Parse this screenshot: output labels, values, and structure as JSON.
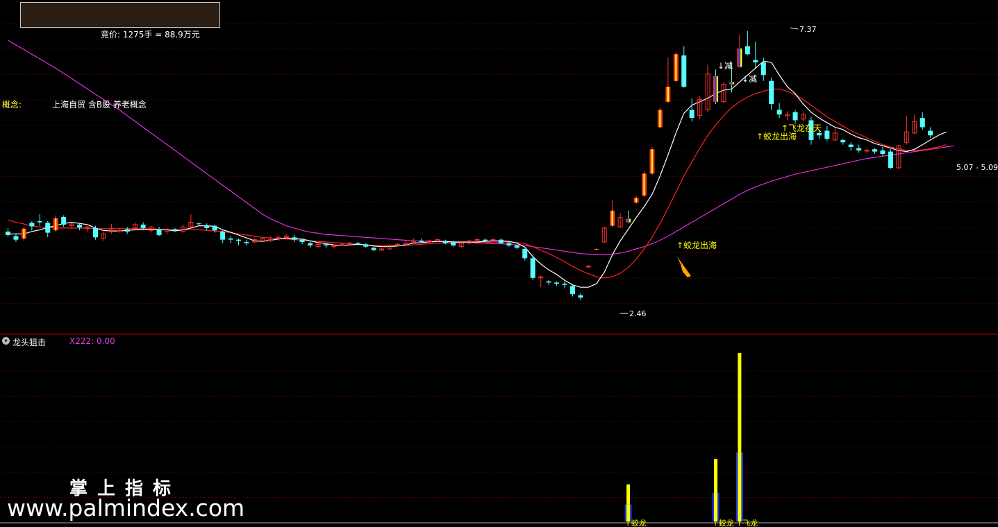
{
  "header": {
    "auction_text": "竞价: 1275手 = 88.9万元",
    "concept_label": "概念:",
    "concept_value": "上海自贸 含B股 养老概念"
  },
  "indicator": {
    "name": "龙头狙击",
    "value_text": "X222: 0.00"
  },
  "watermark": {
    "cn": "掌上指标",
    "url": "www.palmindex.com"
  },
  "colors": {
    "background": "#000000",
    "up_candle": "#ff3232",
    "down_candle": "#54ffff",
    "ma5": "#ffffff",
    "ma10": "#ff2020",
    "ma60": "#e030e0",
    "signal_yellow": "#ffff00",
    "signal_blue": "#2040ff",
    "grid": "#8b0000",
    "pane_border": "#c00000",
    "arrow": "#ffa500"
  },
  "chart_data": {
    "type": "candlestick",
    "price_range": [
      2.2,
      7.8
    ],
    "annotations": {
      "high_label": "7.37",
      "low_label": "2.46",
      "range_label": "5.07 - 5.09",
      "signal_labels": [
        "↓减",
        "↓减",
        "↑蛟龙出海",
        "↑蛟龙出海",
        "↑飞龙在天"
      ],
      "bottom_labels": [
        "↑蛟龙",
        "↑蛟龙",
        "↑飞龙"
      ]
    },
    "candles": [
      [
        3.9,
        3.84,
        3.96,
        3.8
      ],
      [
        3.82,
        3.76,
        3.86,
        3.72
      ],
      [
        3.78,
        3.95,
        3.98,
        3.74
      ],
      [
        4.05,
        3.99,
        4.08,
        3.92
      ],
      [
        4.08,
        4.06,
        4.2,
        4.0
      ],
      [
        4.05,
        3.88,
        4.08,
        3.8
      ],
      [
        3.92,
        4.13,
        4.18,
        3.9
      ],
      [
        4.15,
        4.02,
        4.18,
        3.98
      ],
      [
        4.0,
        4.03,
        4.06,
        3.96
      ],
      [
        4.02,
        3.97,
        4.05,
        3.92
      ],
      [
        3.95,
        3.98,
        4.0,
        3.9
      ],
      [
        3.96,
        3.8,
        4.0,
        3.76
      ],
      [
        3.78,
        3.86,
        3.9,
        3.74
      ],
      [
        3.9,
        3.95,
        4.03,
        3.86
      ],
      [
        3.92,
        3.92,
        3.96,
        3.88
      ],
      [
        3.94,
        3.9,
        3.98,
        3.86
      ],
      [
        3.96,
        4.02,
        4.06,
        3.94
      ],
      [
        4.02,
        3.96,
        4.06,
        3.92
      ],
      [
        3.92,
        3.98,
        4.0,
        3.88
      ],
      [
        3.94,
        3.84,
        3.98,
        3.82
      ],
      [
        3.9,
        3.94,
        3.96,
        3.86
      ],
      [
        3.94,
        3.92,
        3.96,
        3.9
      ],
      [
        3.9,
        3.98,
        4.02,
        3.88
      ],
      [
        3.98,
        4.06,
        4.2,
        3.96
      ],
      [
        4.04,
        4.03,
        4.06,
        4.0
      ],
      [
        4.0,
        3.96,
        4.04,
        3.92
      ],
      [
        4.0,
        3.92,
        4.02,
        3.88
      ],
      [
        3.9,
        3.76,
        3.92,
        3.7
      ],
      [
        3.78,
        3.76,
        3.82,
        3.7
      ],
      [
        3.76,
        3.74,
        3.78,
        3.66
      ],
      [
        3.72,
        3.7,
        3.76,
        3.66
      ],
      [
        3.72,
        3.76,
        3.78,
        3.7
      ],
      [
        3.74,
        3.78,
        3.8,
        3.72
      ],
      [
        3.76,
        3.76,
        3.82,
        3.72
      ],
      [
        3.78,
        3.8,
        3.84,
        3.74
      ],
      [
        3.8,
        3.82,
        3.86,
        3.78
      ],
      [
        3.8,
        3.76,
        3.84,
        3.72
      ],
      [
        3.76,
        3.72,
        3.78,
        3.68
      ],
      [
        3.7,
        3.66,
        3.74,
        3.62
      ],
      [
        3.64,
        3.68,
        3.72,
        3.62
      ],
      [
        3.68,
        3.66,
        3.7,
        3.62
      ],
      [
        3.64,
        3.66,
        3.68,
        3.62
      ],
      [
        3.66,
        3.68,
        3.72,
        3.64
      ],
      [
        3.68,
        3.7,
        3.72,
        3.66
      ],
      [
        3.7,
        3.68,
        3.72,
        3.66
      ],
      [
        3.68,
        3.64,
        3.7,
        3.62
      ],
      [
        3.62,
        3.58,
        3.64,
        3.56
      ],
      [
        3.58,
        3.6,
        3.62,
        3.56
      ],
      [
        3.6,
        3.66,
        3.68,
        3.58
      ],
      [
        3.66,
        3.68,
        3.7,
        3.64
      ],
      [
        3.68,
        3.7,
        3.74,
        3.66
      ],
      [
        3.72,
        3.74,
        3.78,
        3.7
      ],
      [
        3.74,
        3.72,
        3.78,
        3.7
      ],
      [
        3.72,
        3.74,
        3.76,
        3.7
      ],
      [
        3.74,
        3.76,
        3.78,
        3.72
      ],
      [
        3.74,
        3.7,
        3.76,
        3.68
      ],
      [
        3.72,
        3.66,
        3.74,
        3.64
      ],
      [
        3.64,
        3.7,
        3.72,
        3.62
      ],
      [
        3.7,
        3.74,
        3.76,
        3.68
      ],
      [
        3.74,
        3.76,
        3.78,
        3.72
      ],
      [
        3.76,
        3.74,
        3.78,
        3.72
      ],
      [
        3.76,
        3.76,
        3.78,
        3.74
      ],
      [
        3.76,
        3.7,
        3.78,
        3.68
      ],
      [
        3.7,
        3.66,
        3.72,
        3.64
      ],
      [
        3.66,
        3.62,
        3.68,
        3.6
      ],
      [
        3.6,
        3.44,
        3.62,
        3.4
      ],
      [
        3.44,
        3.1,
        3.46,
        3.06
      ],
      [
        3.1,
        3.12,
        3.14,
        2.94
      ],
      [
        3.04,
        3.02,
        3.06,
        2.98
      ],
      [
        3.02,
        3.0,
        3.04,
        2.96
      ],
      [
        3.0,
        2.98,
        3.04,
        2.92
      ],
      [
        2.96,
        2.82,
        2.98,
        2.78
      ],
      [
        2.8,
        2.76,
        2.84,
        2.72
      ],
      [
        3.3,
        3.3,
        3.32,
        3.28
      ],
      [
        3.6,
        3.6,
        3.62,
        3.58
      ],
      [
        3.72,
        3.96,
        3.98,
        3.7
      ],
      [
        4.0,
        4.26,
        4.44,
        3.98
      ],
      [
        3.98,
        4.14,
        4.22,
        3.96
      ],
      [
        4.12,
        4.06,
        4.26,
        4.04
      ],
      [
        4.4,
        4.48,
        4.52,
        4.38
      ],
      [
        4.52,
        4.9,
        4.94,
        4.5
      ],
      [
        4.9,
        5.32,
        5.36,
        4.88
      ],
      [
        5.7,
        6.0,
        6.04,
        5.68
      ],
      [
        6.14,
        6.4,
        6.9,
        6.12
      ],
      [
        6.5,
        6.96,
        7.0,
        6.48
      ],
      [
        6.94,
        6.4,
        7.1,
        6.38
      ],
      [
        6.0,
        5.86,
        6.2,
        5.8
      ],
      [
        5.9,
        6.18,
        6.24,
        5.84
      ],
      [
        6.0,
        6.62,
        6.78,
        5.96
      ],
      [
        6.58,
        6.14,
        6.7,
        6.1
      ],
      [
        6.14,
        6.44,
        6.48,
        6.12
      ],
      [
        6.48,
        6.44,
        6.8,
        6.3
      ],
      [
        6.74,
        7.06,
        7.3,
        6.72
      ],
      [
        7.1,
        6.96,
        7.36,
        6.94
      ],
      [
        6.86,
        6.82,
        7.18,
        6.7
      ],
      [
        6.82,
        6.6,
        6.9,
        6.5
      ],
      [
        6.5,
        6.1,
        6.56,
        6.0
      ],
      [
        6.0,
        5.92,
        6.12,
        5.86
      ],
      [
        5.9,
        5.92,
        5.98,
        5.82
      ],
      [
        5.96,
        5.82,
        6.0,
        5.76
      ],
      [
        5.84,
        5.92,
        5.96,
        5.8
      ],
      [
        5.82,
        5.48,
        5.88,
        5.4
      ],
      [
        5.6,
        5.56,
        5.66,
        5.5
      ],
      [
        5.64,
        5.5,
        5.72,
        5.46
      ],
      [
        5.48,
        5.6,
        5.68,
        5.46
      ],
      [
        5.48,
        5.44,
        5.5,
        5.4
      ],
      [
        5.4,
        5.36,
        5.44,
        5.3
      ],
      [
        5.34,
        5.3,
        5.4,
        5.26
      ],
      [
        5.3,
        5.3,
        5.34,
        5.26
      ],
      [
        5.32,
        5.28,
        5.34,
        5.24
      ],
      [
        5.3,
        5.24,
        5.36,
        5.2
      ],
      [
        5.28,
        5.0,
        5.32,
        4.98
      ],
      [
        5.0,
        5.38,
        5.4,
        4.98
      ],
      [
        5.44,
        5.62,
        5.9,
        5.4
      ],
      [
        5.6,
        5.8,
        5.92,
        5.58
      ],
      [
        5.86,
        5.7,
        5.96,
        5.66
      ],
      [
        5.64,
        5.56,
        5.7,
        5.52
      ]
    ],
    "signal_candles": {
      "red_yellow": [
        2,
        6,
        74,
        76,
        79,
        80,
        81,
        82,
        83,
        84
      ],
      "blue_yellow": [
        78,
        89,
        91,
        92
      ]
    },
    "ma5": [
      3.86,
      3.86,
      3.86,
      3.9,
      3.93,
      3.97,
      4.0,
      4.04,
      4.06,
      4.04,
      4.02,
      3.96,
      3.92,
      3.91,
      3.91,
      3.92,
      3.93,
      3.93,
      3.94,
      3.93,
      3.93,
      3.91,
      3.93,
      3.96,
      4.0,
      4.0,
      3.99,
      3.93,
      3.89,
      3.84,
      3.79,
      3.74,
      3.73,
      3.75,
      3.77,
      3.79,
      3.78,
      3.77,
      3.74,
      3.71,
      3.69,
      3.67,
      3.66,
      3.67,
      3.68,
      3.67,
      3.65,
      3.64,
      3.64,
      3.65,
      3.67,
      3.7,
      3.71,
      3.72,
      3.73,
      3.73,
      3.72,
      3.72,
      3.72,
      3.72,
      3.73,
      3.74,
      3.74,
      3.73,
      3.7,
      3.63,
      3.47,
      3.34,
      3.24,
      3.16,
      3.06,
      2.98,
      2.94,
      2.94,
      3.0,
      3.2,
      3.5,
      3.74,
      3.94,
      4.14,
      4.33,
      4.54,
      4.86,
      5.22,
      5.6,
      5.94,
      6.08,
      6.14,
      6.2,
      6.28,
      6.34,
      6.36,
      6.48,
      6.6,
      6.72,
      6.84,
      6.82,
      6.6,
      6.4,
      6.28,
      6.1,
      5.96,
      5.86,
      5.78,
      5.7,
      5.66,
      5.58,
      5.52,
      5.48,
      5.42,
      5.38,
      5.34,
      5.3,
      5.28,
      5.32,
      5.4,
      5.48,
      5.56,
      5.62
    ],
    "ma10": [
      4.1,
      4.06,
      4.03,
      4.0,
      3.98,
      3.97,
      3.96,
      3.96,
      3.96,
      3.96,
      3.96,
      3.95,
      3.95,
      3.95,
      3.95,
      3.95,
      3.95,
      3.95,
      3.95,
      3.94,
      3.93,
      3.93,
      3.93,
      3.93,
      3.93,
      3.92,
      3.91,
      3.9,
      3.88,
      3.86,
      3.84,
      3.82,
      3.8,
      3.79,
      3.78,
      3.77,
      3.76,
      3.75,
      3.74,
      3.73,
      3.72,
      3.71,
      3.7,
      3.69,
      3.68,
      3.67,
      3.66,
      3.66,
      3.66,
      3.66,
      3.66,
      3.67,
      3.68,
      3.69,
      3.7,
      3.7,
      3.7,
      3.71,
      3.71,
      3.71,
      3.71,
      3.72,
      3.72,
      3.72,
      3.71,
      3.69,
      3.64,
      3.58,
      3.52,
      3.45,
      3.38,
      3.3,
      3.23,
      3.17,
      3.12,
      3.1,
      3.12,
      3.18,
      3.28,
      3.42,
      3.6,
      3.8,
      4.04,
      4.3,
      4.58,
      4.86,
      5.1,
      5.34,
      5.56,
      5.74,
      5.9,
      6.04,
      6.14,
      6.22,
      6.28,
      6.32,
      6.36,
      6.36,
      6.32,
      6.26,
      6.18,
      6.08,
      5.98,
      5.88,
      5.8,
      5.72,
      5.64,
      5.58,
      5.52,
      5.46,
      5.4,
      5.36,
      5.33,
      5.3,
      5.3,
      5.31,
      5.33,
      5.36,
      5.4
    ],
    "ma60": [
      7.2,
      7.12,
      7.04,
      6.96,
      6.88,
      6.8,
      6.72,
      6.63,
      6.54,
      6.45,
      6.36,
      6.27,
      6.18,
      6.09,
      6.0,
      5.9,
      5.8,
      5.7,
      5.6,
      5.5,
      5.4,
      5.3,
      5.2,
      5.1,
      5.0,
      4.9,
      4.8,
      4.7,
      4.6,
      4.5,
      4.4,
      4.3,
      4.2,
      4.12,
      4.06,
      4.0,
      3.96,
      3.92,
      3.89,
      3.87,
      3.85,
      3.84,
      3.83,
      3.82,
      3.81,
      3.8,
      3.79,
      3.78,
      3.77,
      3.76,
      3.75,
      3.74,
      3.74,
      3.73,
      3.73,
      3.72,
      3.72,
      3.71,
      3.71,
      3.7,
      3.7,
      3.69,
      3.69,
      3.68,
      3.67,
      3.66,
      3.64,
      3.62,
      3.6,
      3.58,
      3.56,
      3.54,
      3.52,
      3.51,
      3.5,
      3.5,
      3.51,
      3.53,
      3.56,
      3.6,
      3.64,
      3.69,
      3.75,
      3.82,
      3.9,
      3.98,
      4.06,
      4.14,
      4.22,
      4.3,
      4.38,
      4.46,
      4.54,
      4.61,
      4.67,
      4.72,
      4.77,
      4.81,
      4.85,
      4.89,
      4.92,
      4.95,
      4.98,
      5.01,
      5.04,
      5.07,
      5.1,
      5.13,
      5.16,
      5.18,
      5.2,
      5.22,
      5.24,
      5.26,
      5.28,
      5.3,
      5.32,
      5.34,
      5.36,
      5.38
    ],
    "bars": [
      {
        "index": 78,
        "yellow": 0.22,
        "blue": 0.1
      },
      {
        "index": 89,
        "yellow": 0.37,
        "blue": 0.17
      },
      {
        "index": 92,
        "yellow": 1.0,
        "blue": 0.41
      }
    ]
  }
}
